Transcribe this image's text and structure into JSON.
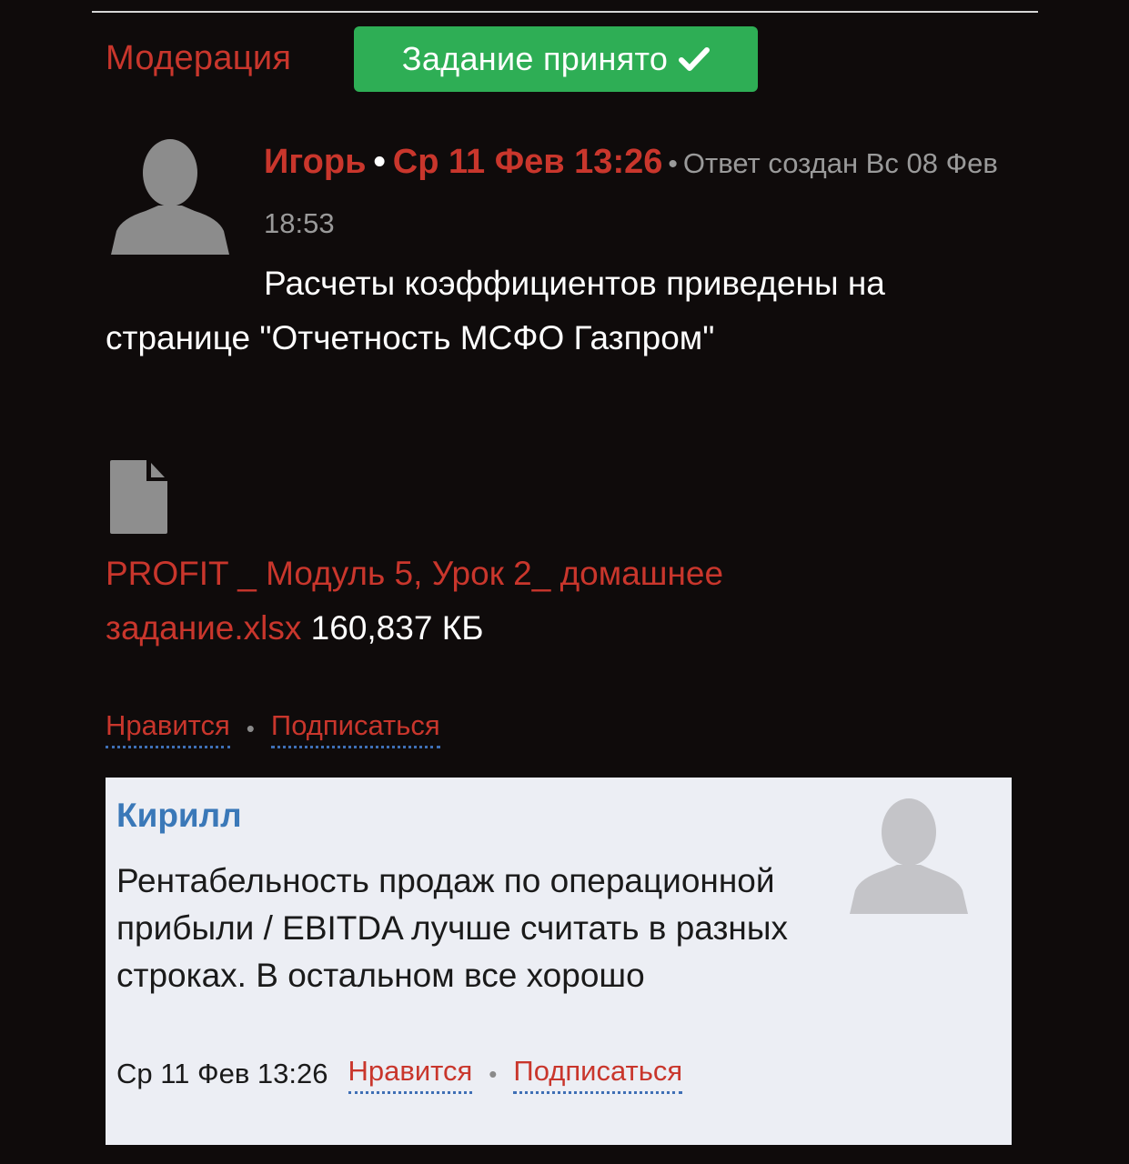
{
  "header": {
    "moderation_label": "Модерация",
    "status_button_label": "Задание принято",
    "status_icon": "checkmark-icon"
  },
  "post": {
    "author": "Игорь",
    "separator": "•",
    "date": "Ср 11 Фев 13:26",
    "small_separator": "•",
    "answer_created": "Ответ создан Вс 08 Фев 18:53",
    "text": "Расчеты коэффициентов приведены на странице \"Отчетность МСФО Газпром\"",
    "attachment": {
      "icon": "file-icon",
      "filename": "PROFIT _ Модуль 5, Урок 2_ домашнее задание.xlsx",
      "size": "160,837 КБ"
    },
    "actions": {
      "like": "Нравится",
      "dot": "•",
      "subscribe": "Подписаться"
    }
  },
  "reply": {
    "author": "Кирилл",
    "text": "Рентабельность продаж по операционной прибыли / EBITDA лучше считать в разных строках. В остальном все хорошо",
    "date": "Ср 11 Фев 13:26",
    "like": "Нравится",
    "dot": "•",
    "subscribe": "Подписаться"
  },
  "colors": {
    "background": "#0f0b0b",
    "accent_red": "#c9362c",
    "success_green": "#2eae55",
    "reply_author_blue": "#3a78b8",
    "reply_card_bg": "#eceef4",
    "muted_gray": "#9a9a9a"
  }
}
